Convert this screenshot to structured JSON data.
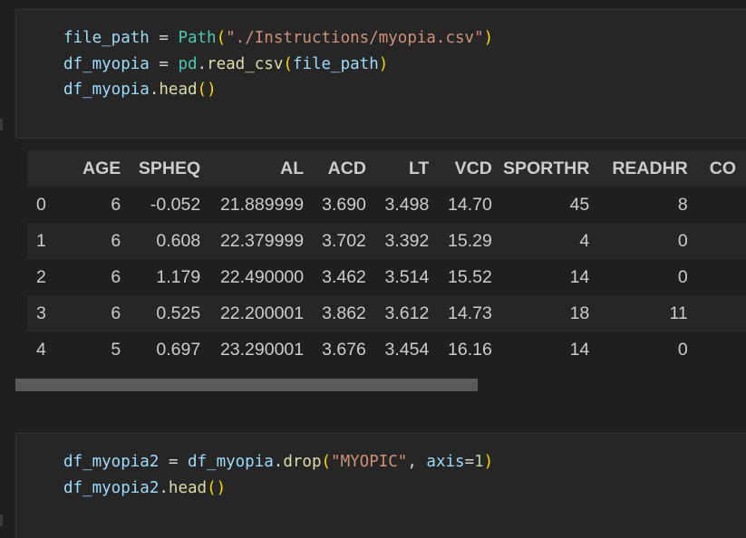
{
  "cells": [
    {
      "lines": [
        [
          {
            "t": "file_path",
            "c": "var"
          },
          {
            "t": " = ",
            "c": "op"
          },
          {
            "t": "Path",
            "c": "cls"
          },
          {
            "t": "(",
            "c": "p1"
          },
          {
            "t": "\"./Instructions/myopia.csv\"",
            "c": "str"
          },
          {
            "t": ")",
            "c": "p1"
          }
        ],
        [
          {
            "t": "df_myopia",
            "c": "var"
          },
          {
            "t": " = ",
            "c": "op"
          },
          {
            "t": "pd",
            "c": "cls"
          },
          {
            "t": ".",
            "c": "op"
          },
          {
            "t": "read_csv",
            "c": "fn"
          },
          {
            "t": "(",
            "c": "p1"
          },
          {
            "t": "file_path",
            "c": "var"
          },
          {
            "t": ")",
            "c": "p1"
          }
        ],
        [
          {
            "t": "df_myopia",
            "c": "var"
          },
          {
            "t": ".",
            "c": "op"
          },
          {
            "t": "head",
            "c": "fn"
          },
          {
            "t": "()",
            "c": "p1"
          }
        ]
      ]
    },
    {
      "lines": [
        [
          {
            "t": "df_myopia2",
            "c": "var"
          },
          {
            "t": " = ",
            "c": "op"
          },
          {
            "t": "df_myopia",
            "c": "var"
          },
          {
            "t": ".",
            "c": "op"
          },
          {
            "t": "drop",
            "c": "fn"
          },
          {
            "t": "(",
            "c": "p1"
          },
          {
            "t": "\"MYOPIC\"",
            "c": "str"
          },
          {
            "t": ", ",
            "c": "op"
          },
          {
            "t": "axis",
            "c": "var"
          },
          {
            "t": "=",
            "c": "op"
          },
          {
            "t": "1",
            "c": "num"
          },
          {
            "t": ")",
            "c": "p1"
          }
        ],
        [
          {
            "t": "df_myopia2",
            "c": "var"
          },
          {
            "t": ".",
            "c": "op"
          },
          {
            "t": "head",
            "c": "fn"
          },
          {
            "t": "()",
            "c": "p1"
          }
        ]
      ]
    }
  ],
  "output_table": {
    "columns": [
      "AGE",
      "SPHEQ",
      "AL",
      "ACD",
      "LT",
      "VCD",
      "SPORTHR",
      "READHR",
      "CO"
    ],
    "rows": [
      {
        "index": "0",
        "values": [
          "6",
          "-0.052",
          "21.889999",
          "3.690",
          "3.498",
          "14.70",
          "45",
          "8",
          ""
        ]
      },
      {
        "index": "1",
        "values": [
          "6",
          "0.608",
          "22.379999",
          "3.702",
          "3.392",
          "15.29",
          "4",
          "0",
          ""
        ]
      },
      {
        "index": "2",
        "values": [
          "6",
          "1.179",
          "22.490000",
          "3.462",
          "3.514",
          "15.52",
          "14",
          "0",
          ""
        ]
      },
      {
        "index": "3",
        "values": [
          "6",
          "0.525",
          "22.200001",
          "3.862",
          "3.612",
          "14.73",
          "18",
          "11",
          ""
        ]
      },
      {
        "index": "4",
        "values": [
          "5",
          "0.697",
          "23.290001",
          "3.676",
          "3.454",
          "16.16",
          "14",
          "0",
          ""
        ]
      }
    ]
  }
}
